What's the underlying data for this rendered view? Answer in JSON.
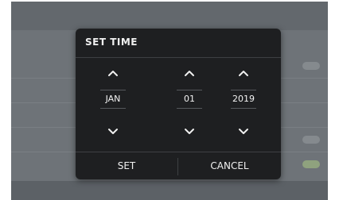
{
  "dialog": {
    "title": "SET TIME",
    "columns": [
      {
        "value": "JAN"
      },
      {
        "value": "01"
      },
      {
        "value": "2019"
      }
    ],
    "set_label": "SET",
    "cancel_label": "CANCEL"
  },
  "colors": {
    "dialog_bg": "#1e1f21",
    "text": "#f0f0f0",
    "toggle_on": "#8fa27e"
  }
}
